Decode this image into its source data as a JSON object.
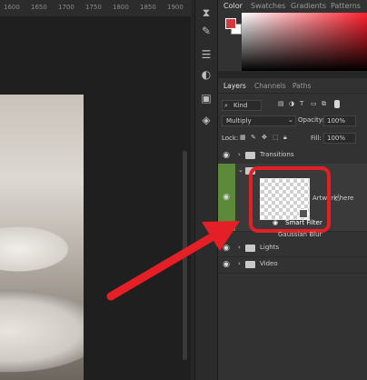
{
  "ruler": {
    "marks": [
      "1600",
      "1650",
      "1700",
      "1750",
      "1800",
      "1850",
      "1900"
    ]
  },
  "top_panel": {
    "tabs": [
      "Color",
      "Swatches",
      "Gradients",
      "Patterns"
    ],
    "active_tab": "Color",
    "colors": {
      "foreground": "#d23a3e",
      "background": "#ffffff"
    }
  },
  "layers_panel": {
    "tabs": [
      "Layers",
      "Channels",
      "Paths"
    ],
    "active_tab": "Layers",
    "filter_kind": "Kind",
    "blend_mode": "Multiply",
    "opacity_label": "Opacity:",
    "opacity_value": "100%",
    "lock_label": "Lock:",
    "fill_label": "Fill:",
    "fill_value": "100%",
    "layers": [
      {
        "name": "Transitions"
      },
      {
        "name": "Artwork here",
        "note": "Smart Filter",
        "filter": "Gaussian Blur"
      },
      {
        "name": "Lights"
      },
      {
        "name": "Video"
      }
    ]
  },
  "icons": {
    "eye": "eye-icon",
    "folder": "folder-icon",
    "chevron": "chevron-right-icon",
    "cursor": "hand-cursor-icon"
  },
  "annotation": {
    "color": "#e41f26"
  }
}
